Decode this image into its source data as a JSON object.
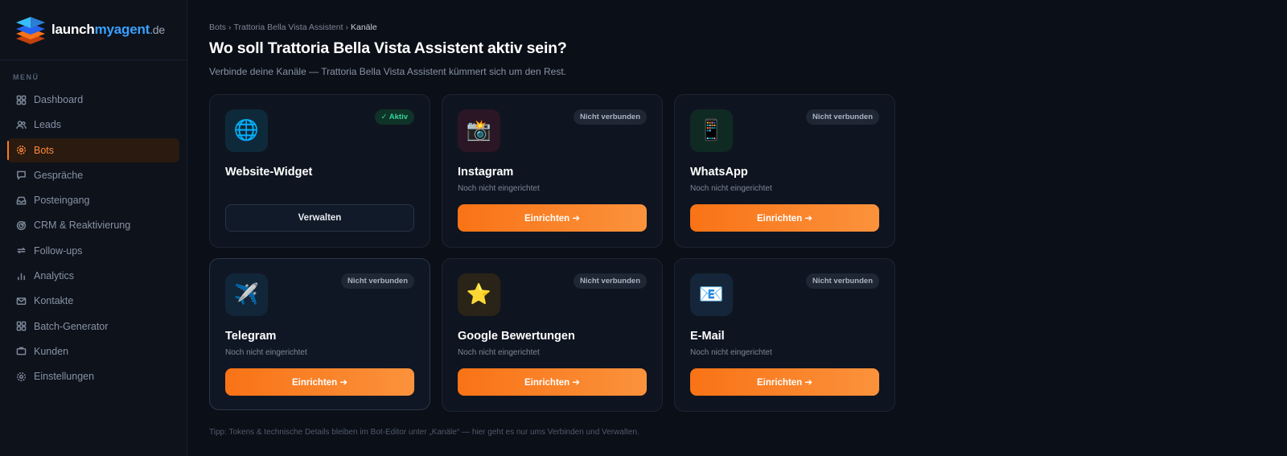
{
  "brand": {
    "part1": "launch",
    "part2": "myagent",
    "part3": ".de"
  },
  "sidebar": {
    "menu_label": "MENÜ",
    "items": [
      {
        "label": "Dashboard",
        "icon": "grid-icon"
      },
      {
        "label": "Leads",
        "icon": "users-icon"
      },
      {
        "label": "Bots",
        "icon": "gear-icon",
        "active": true
      },
      {
        "label": "Gespräche",
        "icon": "chat-icon"
      },
      {
        "label": "Posteingang",
        "icon": "inbox-icon"
      },
      {
        "label": "CRM & Reaktivierung",
        "icon": "target-icon"
      },
      {
        "label": "Follow-ups",
        "icon": "repeat-icon"
      },
      {
        "label": "Analytics",
        "icon": "bar-chart-icon"
      },
      {
        "label": "Kontakte",
        "icon": "mail-icon"
      },
      {
        "label": "Batch-Generator",
        "icon": "grid-icon"
      },
      {
        "label": "Kunden",
        "icon": "briefcase-icon"
      },
      {
        "label": "Einstellungen",
        "icon": "gear-icon"
      }
    ]
  },
  "breadcrumb": {
    "b1": "Bots",
    "b2": "Trattoria Bella Vista Assistent",
    "b3": "Kanäle",
    "sep": "›"
  },
  "page": {
    "title": "Wo soll Trattoria Bella Vista Assistent aktiv sein?",
    "subtitle": "Verbinde deine Kanäle — Trattoria Bella Vista Assistent kümmert sich um den Rest."
  },
  "channels": [
    {
      "name": "Website-Widget",
      "desc": "",
      "badge": "✓ Aktiv",
      "button": "Verwalten",
      "icon": "🌐",
      "icon_bg": "#0e2a3a"
    },
    {
      "name": "Instagram",
      "desc": "Noch nicht eingerichtet",
      "badge": "Nicht verbunden",
      "button": "Einrichten ➔",
      "icon": "📸",
      "icon_bg": "#2a1624"
    },
    {
      "name": "WhatsApp",
      "desc": "Noch nicht eingerichtet",
      "badge": "Nicht verbunden",
      "button": "Einrichten ➔",
      "icon": "📱",
      "icon_bg": "#0f2a22"
    },
    {
      "name": "Telegram",
      "desc": "Noch nicht eingerichtet",
      "badge": "Nicht verbunden",
      "button": "Einrichten ➔",
      "icon": "✈️",
      "icon_bg": "#12263a"
    },
    {
      "name": "Google Bewertungen",
      "desc": "Noch nicht eingerichtet",
      "badge": "Nicht verbunden",
      "button": "Einrichten ➔",
      "icon": "⭐",
      "icon_bg": "#2a2418"
    },
    {
      "name": "E-Mail",
      "desc": "Noch nicht eingerichtet",
      "badge": "Nicht verbunden",
      "button": "Einrichten ➔",
      "icon": "📧",
      "icon_bg": "#15263a"
    }
  ],
  "tip": "Tipp: Tokens & technische Details bleiben im Bot-Editor unter „Kanäle“ — hier geht es nur ums Verbinden und Verwalten.",
  "colors": {
    "accent": "#f97316",
    "active_badge": "#34d399",
    "background": "#0b0f17"
  }
}
